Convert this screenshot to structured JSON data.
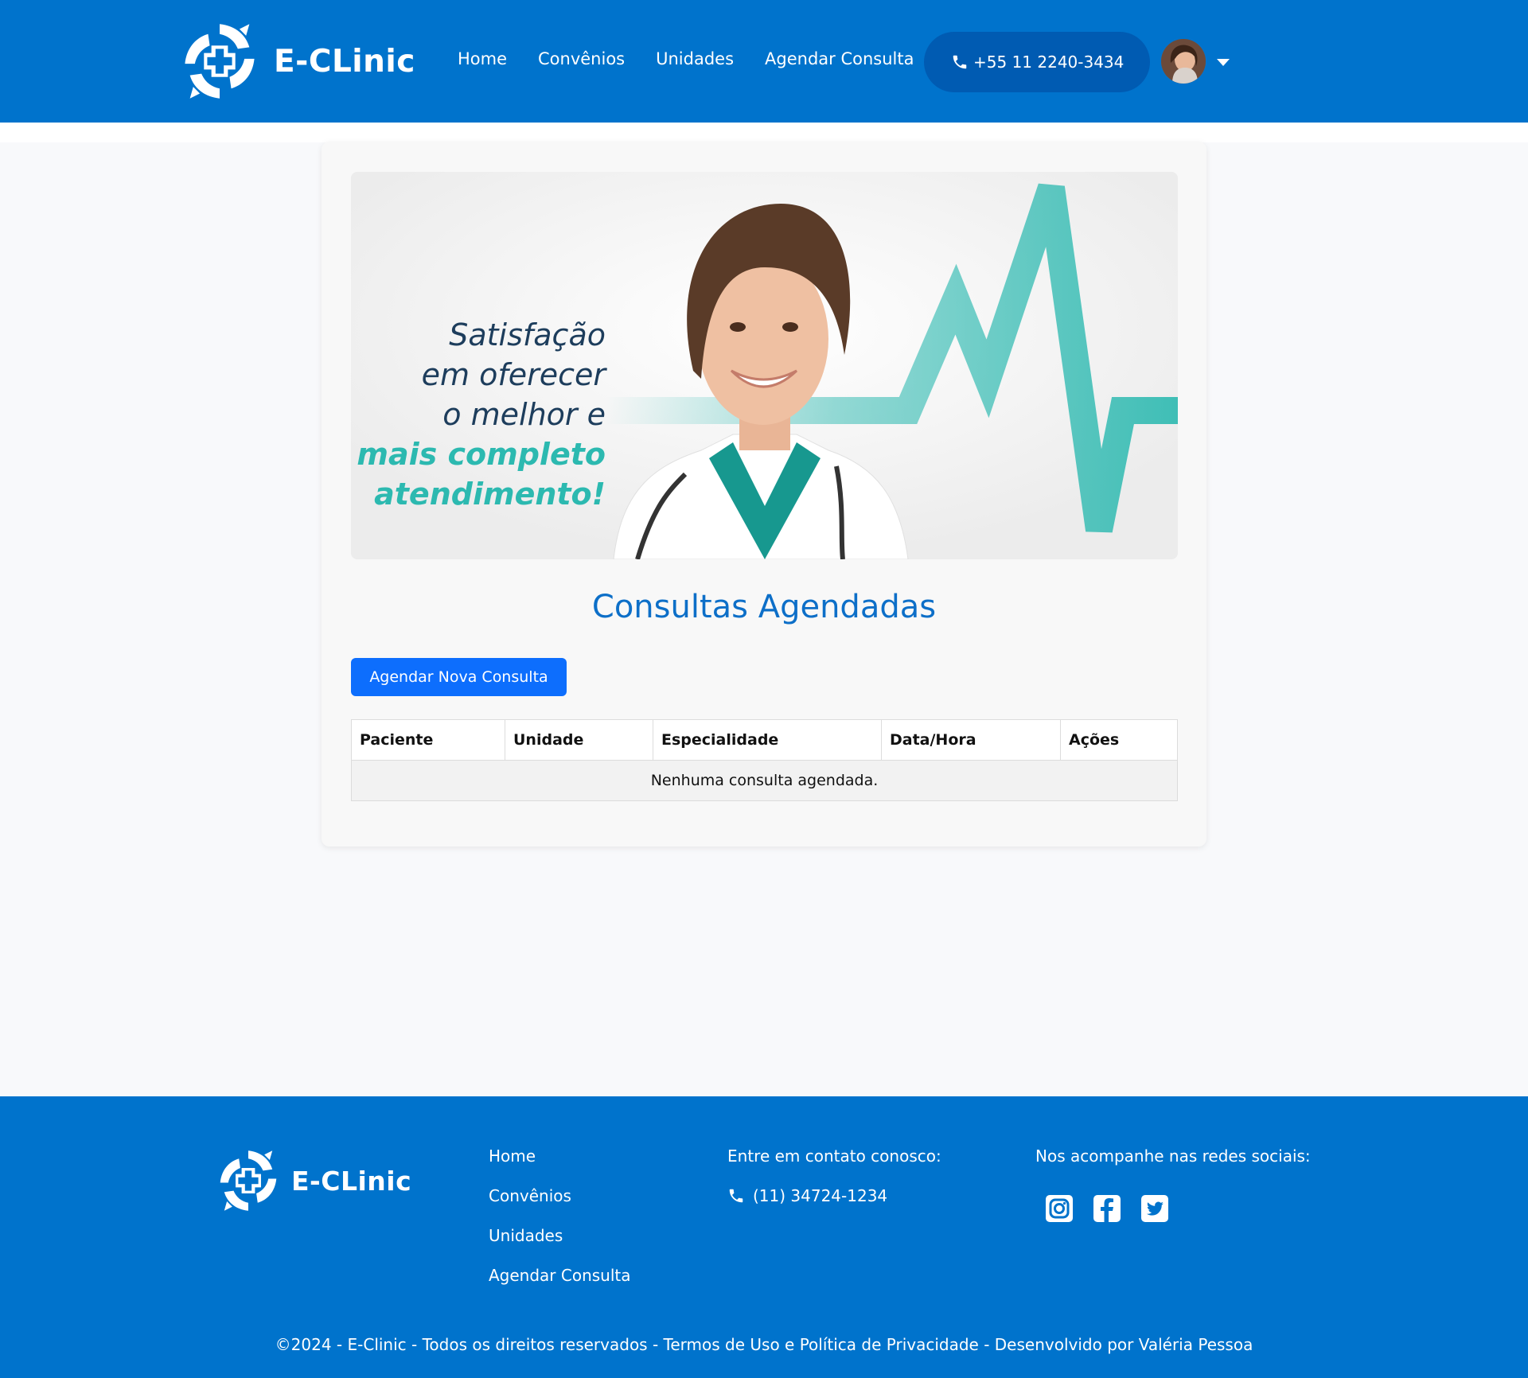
{
  "brand": {
    "name": "E-CLinic"
  },
  "nav": {
    "items": [
      "Home",
      "Convênios",
      "Unidades",
      "Agendar Consulta"
    ],
    "phone": "+55 11 2240-3434"
  },
  "banner": {
    "lines": [
      "Satisfação",
      "em oferecer",
      "o melhor e"
    ],
    "highlight_lines": [
      "mais completo",
      "atendimento!"
    ]
  },
  "main": {
    "title": "Consultas Agendadas",
    "new_button": "Agendar Nova Consulta",
    "table": {
      "columns": [
        "Paciente",
        "Unidade",
        "Especialidade",
        "Data/Hora",
        "Ações"
      ],
      "empty_message": "Nenhuma consulta agendada."
    }
  },
  "footer": {
    "links": [
      "Home",
      "Convênios",
      "Unidades",
      "Agendar Consulta"
    ],
    "contact_title": "Entre em contato conosco:",
    "contact_phone": "(11) 34724-1234",
    "social_title": "Nos acompanhe nas redes sociais:",
    "social_icons": [
      "instagram-icon",
      "facebook-icon",
      "twitter-icon"
    ],
    "copyright": "©2024 - E-Clinic - Todos os direitos reservados - Termos de Uso e Política de Privacidade - Desenvolvido por Valéria Pessoa"
  },
  "colors": {
    "brand_blue": "#0073cc",
    "button_blue": "#0d6efd",
    "accent_teal": "#2cb9b0",
    "title_blue": "#0d6fc8"
  }
}
